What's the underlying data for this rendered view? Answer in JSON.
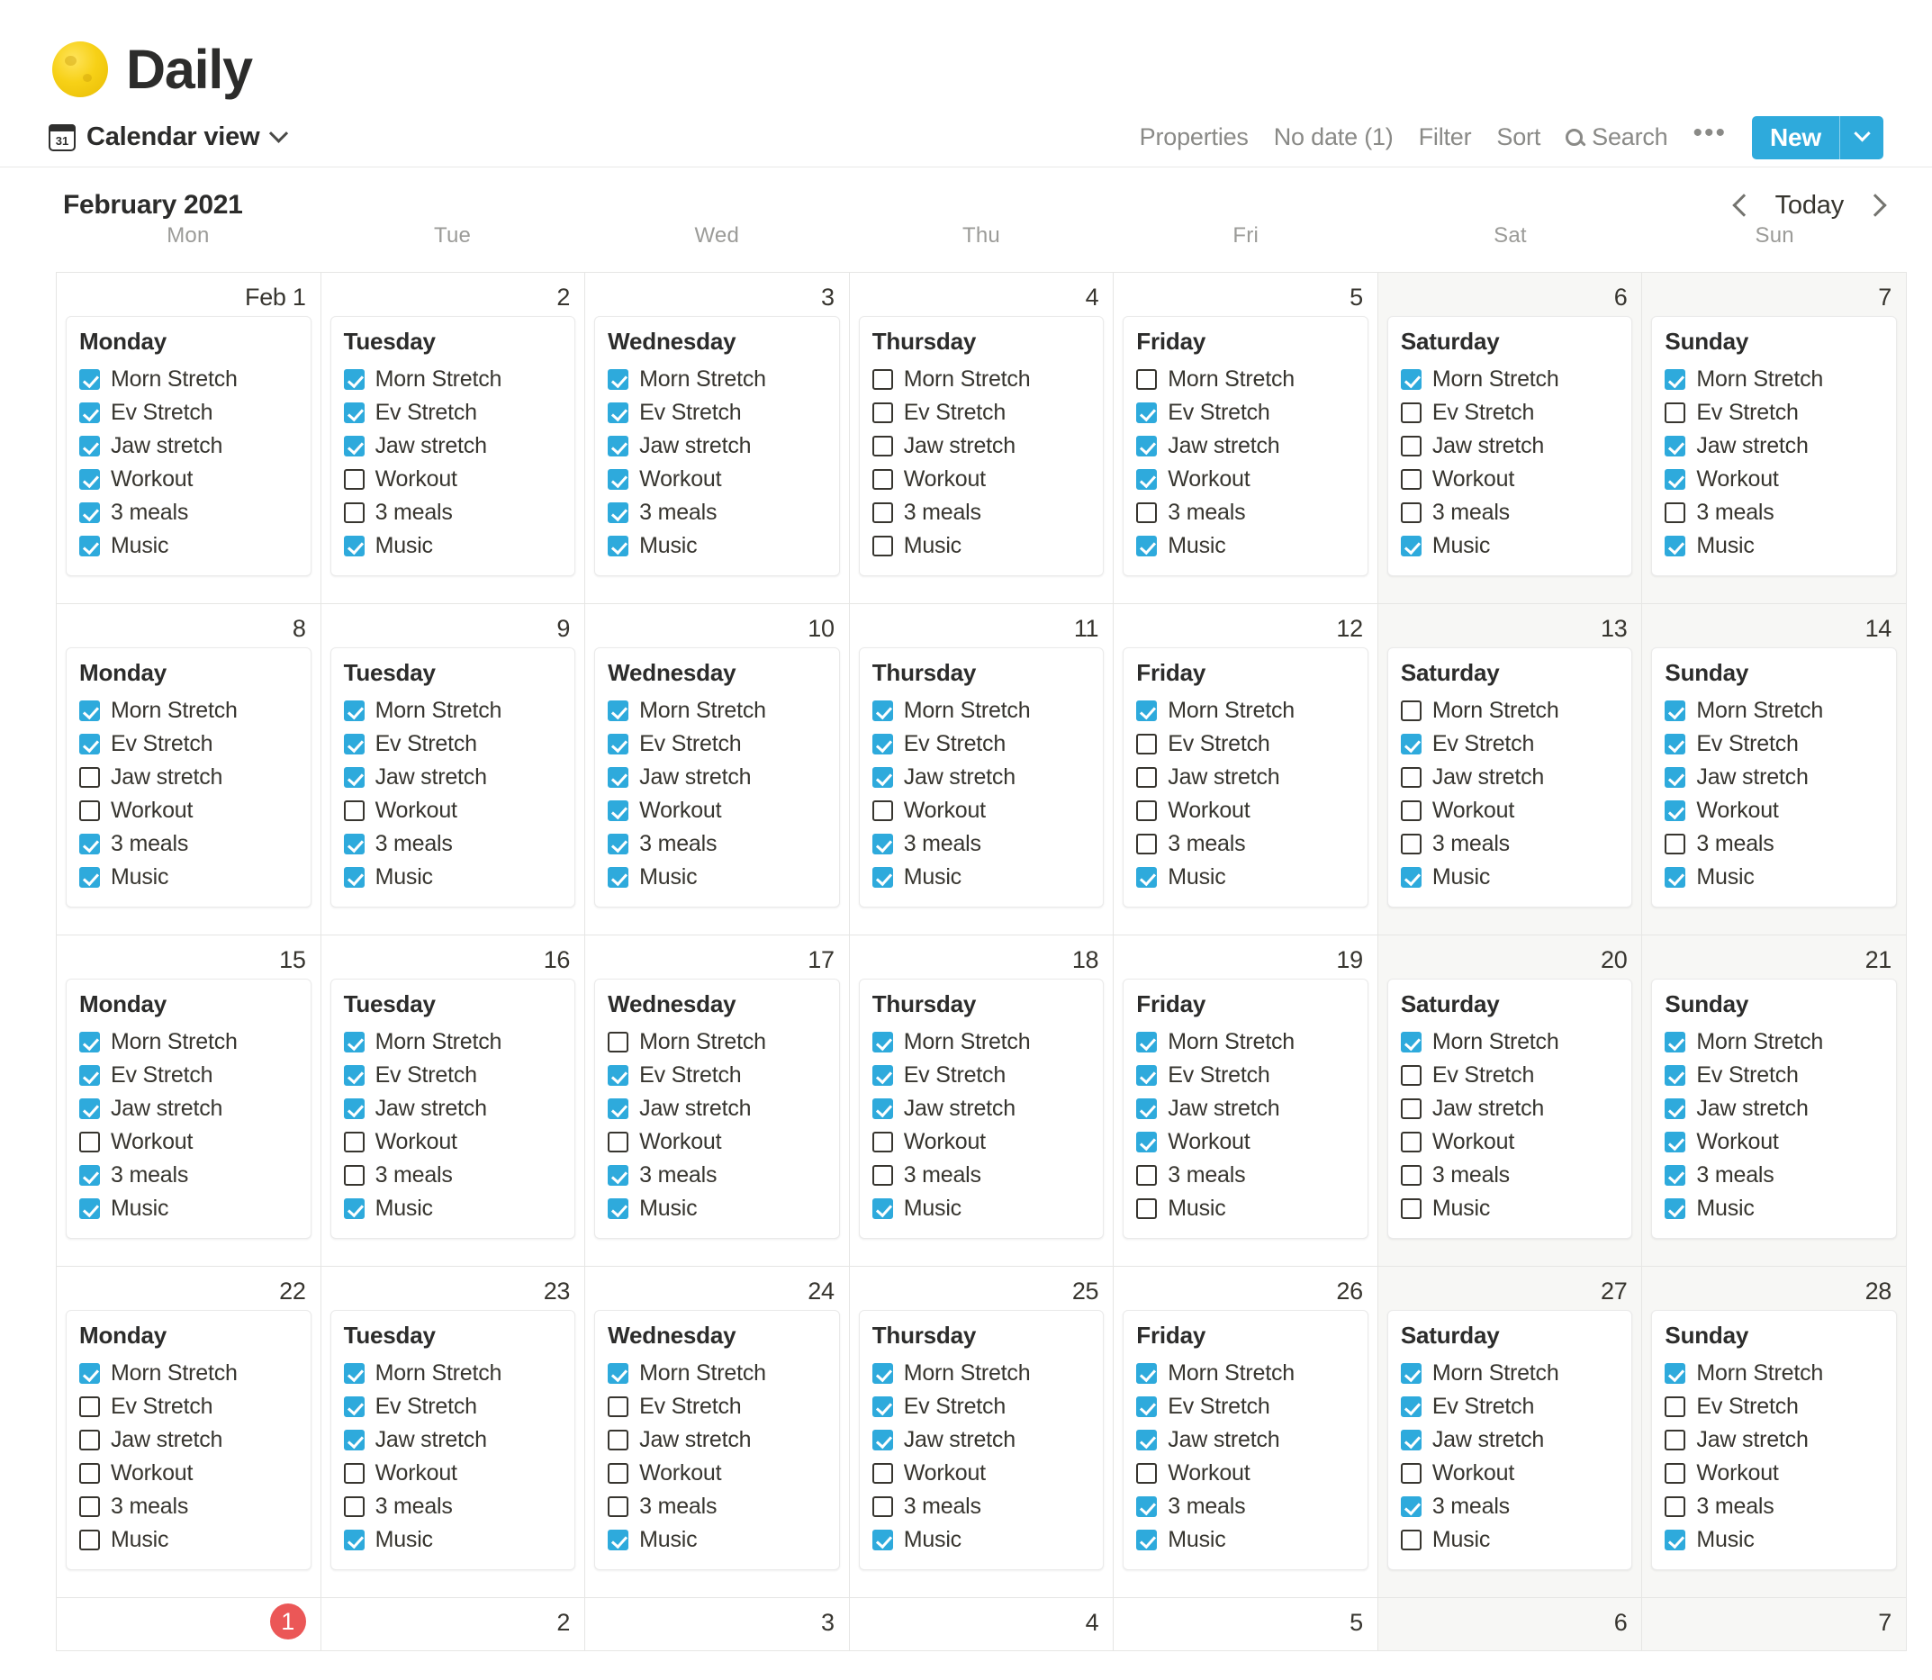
{
  "page": {
    "emoji_name": "full-moon",
    "title": "Daily"
  },
  "toolbar": {
    "view_icon": "calendar-icon",
    "view_icon_glyph": "31",
    "view_name": "Calendar view",
    "properties": "Properties",
    "no_date": "No date (1)",
    "filter": "Filter",
    "sort": "Sort",
    "search": "Search",
    "more": "•••",
    "new_label": "New",
    "accent_color": "#2eaadc"
  },
  "calendar": {
    "month_label": "February 2021",
    "today_label": "Today",
    "weekdays": [
      "Mon",
      "Tue",
      "Wed",
      "Thu",
      "Fri",
      "Sat",
      "Sun"
    ],
    "task_names": [
      "Morn Stretch",
      "Ev Stretch",
      "Jaw stretch",
      "Workout",
      "3 meals",
      "Music"
    ],
    "checkbox_checked_color": "#2eaadc",
    "today_badge_color": "#eb5757",
    "weeks": [
      [
        {
          "num": "Feb 1",
          "weekend": false,
          "event": "Monday",
          "checks": [
            true,
            true,
            true,
            true,
            true,
            true
          ]
        },
        {
          "num": "2",
          "weekend": false,
          "event": "Tuesday",
          "checks": [
            true,
            true,
            true,
            false,
            false,
            true
          ]
        },
        {
          "num": "3",
          "weekend": false,
          "event": "Wednesday",
          "checks": [
            true,
            true,
            true,
            true,
            true,
            true
          ]
        },
        {
          "num": "4",
          "weekend": false,
          "event": "Thursday",
          "checks": [
            false,
            false,
            false,
            false,
            false,
            false
          ]
        },
        {
          "num": "5",
          "weekend": false,
          "event": "Friday",
          "checks": [
            false,
            true,
            true,
            true,
            false,
            true
          ]
        },
        {
          "num": "6",
          "weekend": true,
          "event": "Saturday",
          "checks": [
            true,
            false,
            false,
            false,
            false,
            true
          ]
        },
        {
          "num": "7",
          "weekend": true,
          "event": "Sunday",
          "checks": [
            true,
            false,
            true,
            true,
            false,
            true
          ]
        }
      ],
      [
        {
          "num": "8",
          "weekend": false,
          "event": "Monday",
          "checks": [
            true,
            true,
            false,
            false,
            true,
            true
          ]
        },
        {
          "num": "9",
          "weekend": false,
          "event": "Tuesday",
          "checks": [
            true,
            true,
            true,
            false,
            true,
            true
          ]
        },
        {
          "num": "10",
          "weekend": false,
          "event": "Wednesday",
          "checks": [
            true,
            true,
            true,
            true,
            true,
            true
          ]
        },
        {
          "num": "11",
          "weekend": false,
          "event": "Thursday",
          "checks": [
            true,
            true,
            true,
            false,
            true,
            true
          ]
        },
        {
          "num": "12",
          "weekend": false,
          "event": "Friday",
          "checks": [
            true,
            false,
            false,
            false,
            false,
            true
          ]
        },
        {
          "num": "13",
          "weekend": true,
          "event": "Saturday",
          "checks": [
            false,
            true,
            false,
            false,
            false,
            true
          ]
        },
        {
          "num": "14",
          "weekend": true,
          "event": "Sunday",
          "checks": [
            true,
            true,
            true,
            true,
            false,
            true
          ]
        }
      ],
      [
        {
          "num": "15",
          "weekend": false,
          "event": "Monday",
          "checks": [
            true,
            true,
            true,
            false,
            true,
            true
          ]
        },
        {
          "num": "16",
          "weekend": false,
          "event": "Tuesday",
          "checks": [
            true,
            true,
            true,
            false,
            false,
            true
          ]
        },
        {
          "num": "17",
          "weekend": false,
          "event": "Wednesday",
          "checks": [
            false,
            true,
            true,
            false,
            true,
            true
          ]
        },
        {
          "num": "18",
          "weekend": false,
          "event": "Thursday",
          "checks": [
            true,
            true,
            true,
            false,
            false,
            true
          ]
        },
        {
          "num": "19",
          "weekend": false,
          "event": "Friday",
          "checks": [
            true,
            true,
            true,
            true,
            false,
            false
          ]
        },
        {
          "num": "20",
          "weekend": true,
          "event": "Saturday",
          "checks": [
            true,
            false,
            false,
            false,
            false,
            false
          ]
        },
        {
          "num": "21",
          "weekend": true,
          "event": "Sunday",
          "checks": [
            true,
            true,
            true,
            true,
            true,
            true
          ]
        }
      ],
      [
        {
          "num": "22",
          "weekend": false,
          "event": "Monday",
          "checks": [
            true,
            false,
            false,
            false,
            false,
            false
          ]
        },
        {
          "num": "23",
          "weekend": false,
          "event": "Tuesday",
          "checks": [
            true,
            true,
            true,
            false,
            false,
            true
          ]
        },
        {
          "num": "24",
          "weekend": false,
          "event": "Wednesday",
          "checks": [
            true,
            false,
            false,
            false,
            false,
            true
          ]
        },
        {
          "num": "25",
          "weekend": false,
          "event": "Thursday",
          "checks": [
            true,
            true,
            true,
            false,
            false,
            true
          ]
        },
        {
          "num": "26",
          "weekend": false,
          "event": "Friday",
          "checks": [
            true,
            true,
            true,
            false,
            true,
            true
          ]
        },
        {
          "num": "27",
          "weekend": true,
          "event": "Saturday",
          "checks": [
            true,
            true,
            true,
            false,
            true,
            false
          ]
        },
        {
          "num": "28",
          "weekend": true,
          "event": "Sunday",
          "checks": [
            true,
            false,
            false,
            false,
            false,
            true
          ]
        }
      ]
    ],
    "partial_week": [
      {
        "num": "1",
        "weekend": false,
        "today": true
      },
      {
        "num": "2",
        "weekend": false,
        "today": false
      },
      {
        "num": "3",
        "weekend": false,
        "today": false
      },
      {
        "num": "4",
        "weekend": false,
        "today": false
      },
      {
        "num": "5",
        "weekend": false,
        "today": false
      },
      {
        "num": "6",
        "weekend": true,
        "today": false
      },
      {
        "num": "7",
        "weekend": true,
        "today": false
      }
    ]
  }
}
